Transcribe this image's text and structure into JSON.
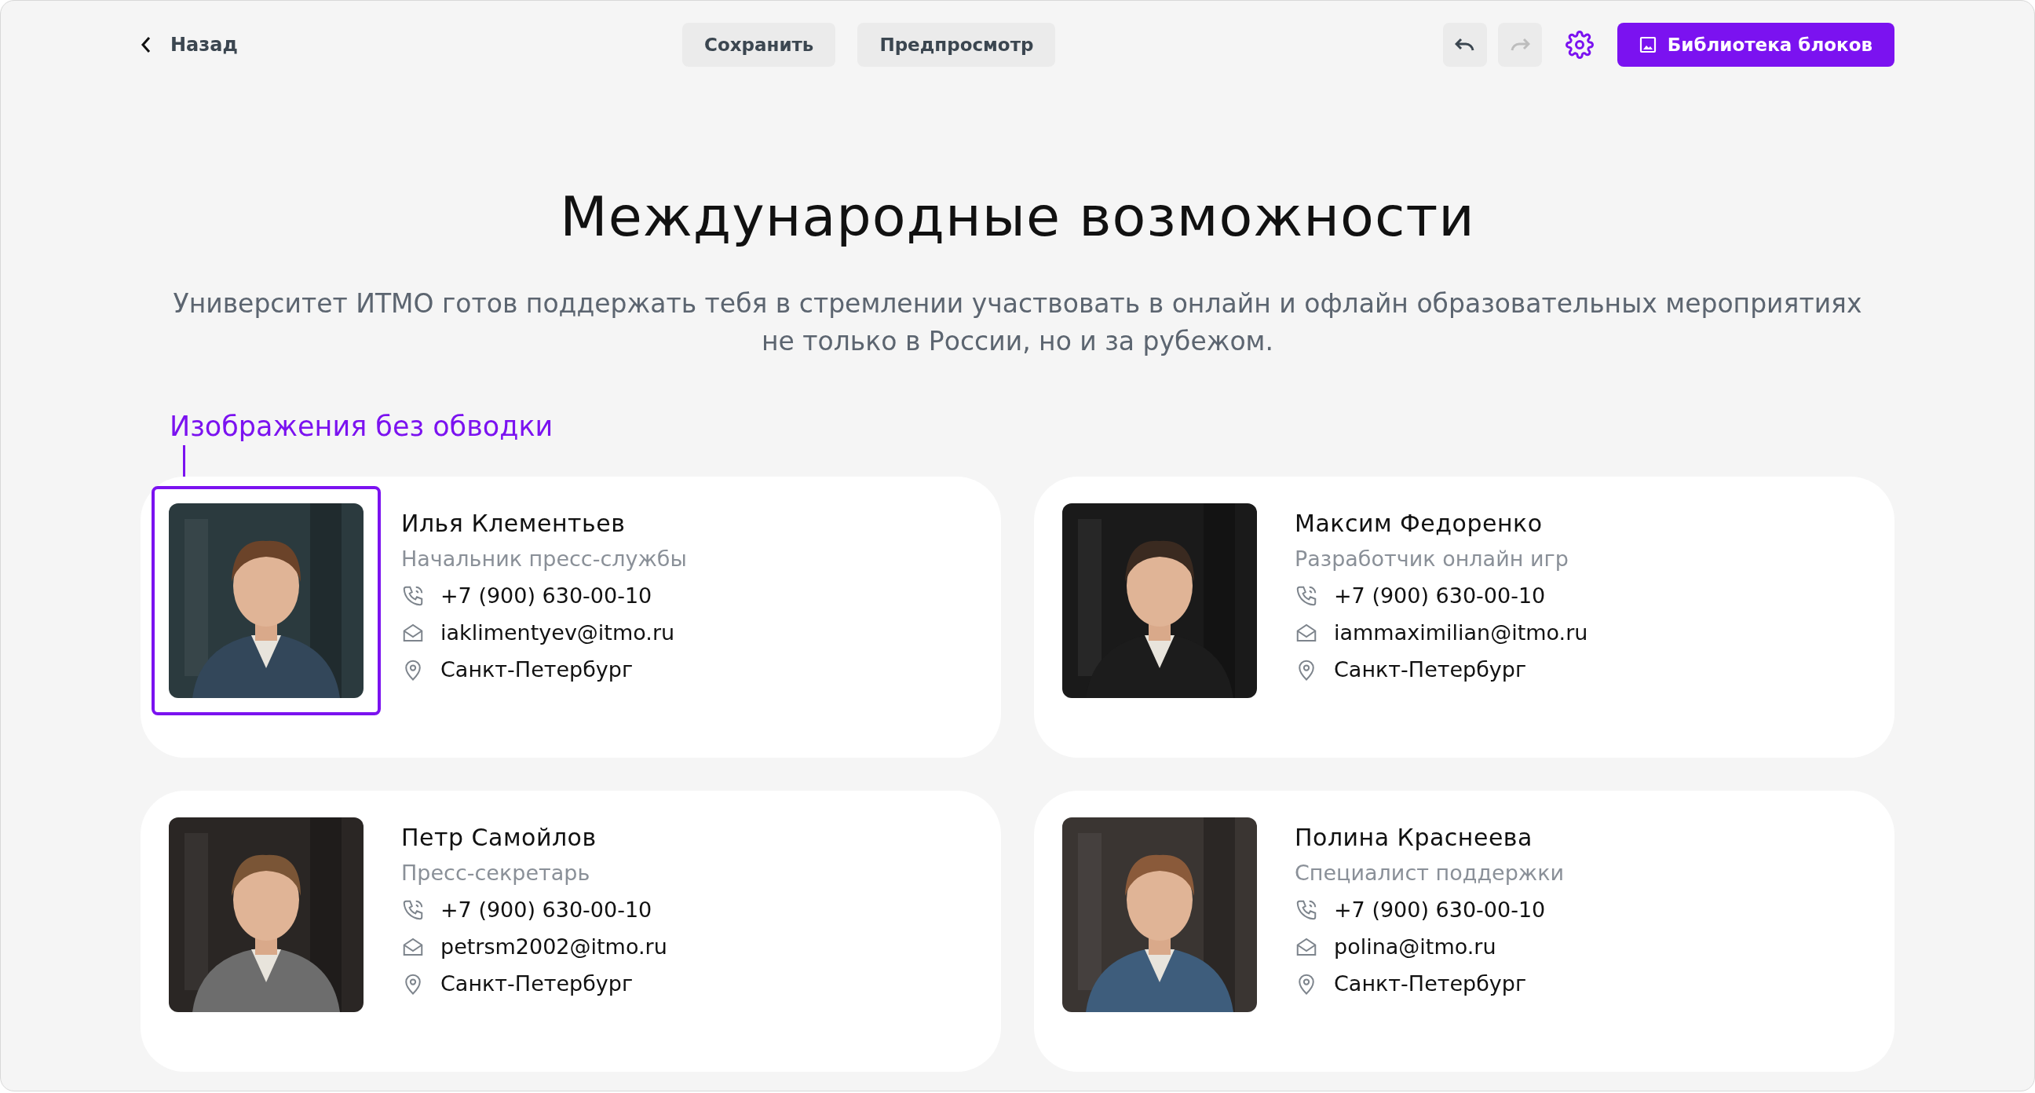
{
  "toolbar": {
    "back": "Назад",
    "save": "Сохранить",
    "preview": "Предпросмотр",
    "undo_disabled": false,
    "redo_disabled": true,
    "library": "Библиотека блоков"
  },
  "title": "Международные возможности",
  "description": "Университет ИТМО готов поддержать тебя в стремлении участвовать в онлайн и офлайн образовательных мероприятиях не только в России, но и за рубежом.",
  "annotation": "Изображения без обводки",
  "cards": [
    {
      "name": "Илья Клементьев",
      "role": "Начальник пресс-службы",
      "phone": "+7 (900) 630-00-10",
      "email": "iaklimentyev@itmo.ru",
      "city": "Санкт-Петербург",
      "selected": true
    },
    {
      "name": "Максим Федоренко",
      "role": "Разработчик онлайн игр",
      "phone": "+7 (900) 630-00-10",
      "email": "iammaximilian@itmo.ru",
      "city": "Санкт-Петербург",
      "selected": false
    },
    {
      "name": "Петр Самойлов",
      "role": "Пресс-секретарь",
      "phone": "+7 (900) 630-00-10",
      "email": "petrsm2002@itmo.ru",
      "city": "Санкт-Петербург",
      "selected": false
    },
    {
      "name": "Полина Краснеева",
      "role": "Специалист поддержки",
      "phone": "+7 (900) 630-00-10",
      "email": "polina@itmo.ru",
      "city": "Санкт-Петербург",
      "selected": false
    }
  ]
}
